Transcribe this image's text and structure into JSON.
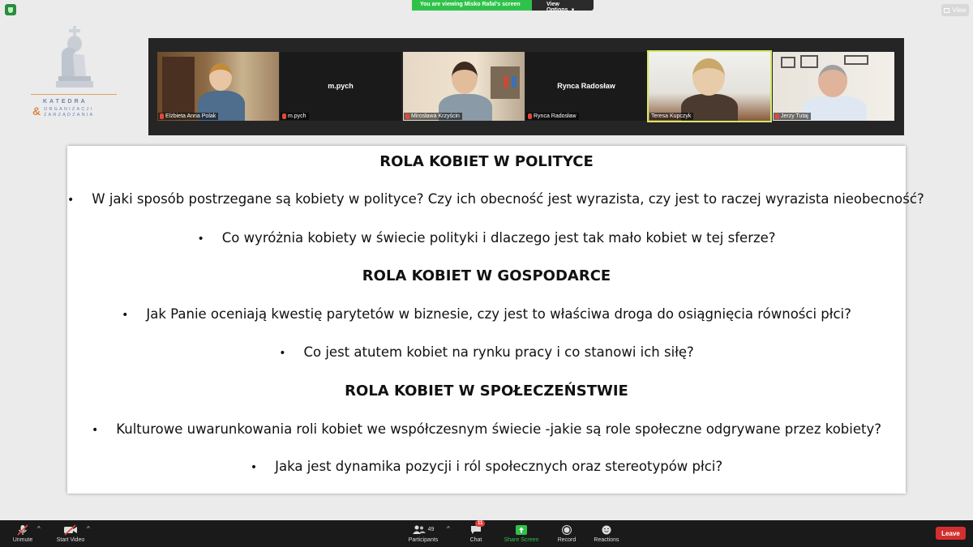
{
  "banner": {
    "viewing_text": "You are viewing Misko Rafal's screen",
    "view_options": "View Options"
  },
  "view_button": "View",
  "logo": {
    "line1": "KATEDRA",
    "amp": "&",
    "line2": "ORGANIZACJI",
    "line3": "ZARZĄDZANIA"
  },
  "participants_strip": [
    {
      "name": "Elżbieta Anna Polak",
      "video": true
    },
    {
      "name": "m.pych",
      "display": "m.pych",
      "video": false
    },
    {
      "name": "Mirosława Krzyścin",
      "video": true
    },
    {
      "name": "Rynca Radosław",
      "display": "Rynca Radosław",
      "video": false
    },
    {
      "name": "Teresa Kupczyk",
      "video": true,
      "active_speaker": true
    },
    {
      "name": "Jerzy Tutaj",
      "video": true
    }
  ],
  "slide": {
    "heading1": "ROLA KOBIET W POLITYCE",
    "bullet1": "W jaki sposób postrzegane są kobiety w polityce? Czy ich obecność jest wyrazista, czy jest to raczej wyrazista nieobecność?",
    "bullet2": "Co wyróżnia kobiety w świecie polityki i dlaczego jest tak mało kobiet w tej sferze?",
    "heading2": "ROLA KOBIET W GOSPODARCE",
    "bullet3": "Jak Panie oceniają kwestię parytetów w biznesie, czy jest to właściwa droga do osiągnięcia równości płci?",
    "bullet4": "Co jest atutem kobiet na rynku pracy i co stanowi ich siłę?",
    "heading3": "ROLA KOBIET W SPOŁECZEŃSTWIE",
    "bullet5": "Kulturowe uwarunkowania roli kobiet we współczesnym świecie -jakie są role społeczne odgrywane przez kobiety?",
    "bullet6": "Jaka jest dynamika pozycji i ról społecznych oraz stereotypów płci?",
    "bullet_char": "•"
  },
  "toolbar": {
    "unmute": "Unmute",
    "start_video": "Start Video",
    "participants": "Participants",
    "participants_count": "49",
    "chat": "Chat",
    "chat_badge": "11",
    "share_screen": "Share Screen",
    "record": "Record",
    "reactions": "Reactions",
    "leave": "Leave"
  },
  "colors": {
    "share_green": "#2fc24a",
    "leave_red": "#d42f2f",
    "active_speaker": "#d6e86a"
  }
}
